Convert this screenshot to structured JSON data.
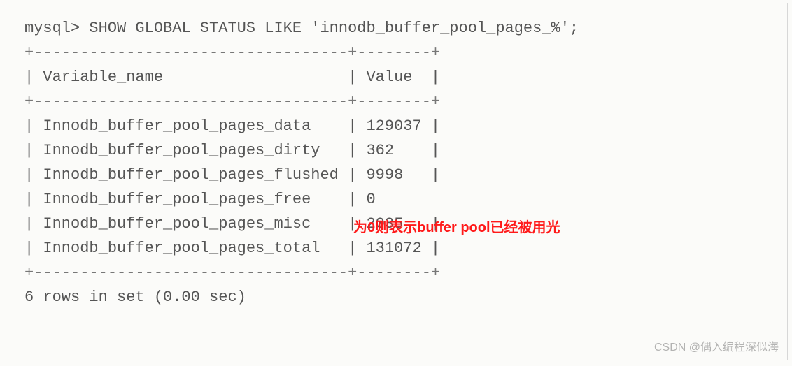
{
  "prompt": "mysql> ",
  "command": "SHOW GLOBAL STATUS LIKE 'innodb_buffer_pool_pages_%';",
  "border_top": "+----------------------------------+--------+",
  "header_line": "| Variable_name                    | Value  |",
  "border_mid": "+----------------------------------+--------+",
  "rows": [
    {
      "line": "| Innodb_buffer_pool_pages_data    | 129037 |",
      "name": "Innodb_buffer_pool_pages_data",
      "value": "129037"
    },
    {
      "line": "| Innodb_buffer_pool_pages_dirty   | 362    |",
      "name": "Innodb_buffer_pool_pages_dirty",
      "value": "362"
    },
    {
      "line": "| Innodb_buffer_pool_pages_flushed | 9998   |",
      "name": "Innodb_buffer_pool_pages_flushed",
      "value": "9998"
    },
    {
      "line": "| Innodb_buffer_pool_pages_free    | 0",
      "name": "Innodb_buffer_pool_pages_free",
      "value": "0"
    },
    {
      "line": "| Innodb_buffer_pool_pages_misc    | 2035   |",
      "name": "Innodb_buffer_pool_pages_misc",
      "value": "2035"
    },
    {
      "line": "| Innodb_buffer_pool_pages_total   | 131072 |",
      "name": "Innodb_buffer_pool_pages_total",
      "value": "131072"
    }
  ],
  "border_bot": "+----------------------------------+--------+",
  "footer": "6 rows in set (0.00 sec)",
  "annotation": "为0则表示buffer pool已经被用光",
  "watermark": "CSDN @偶入编程深似海",
  "chart_data": {
    "type": "table",
    "title": "SHOW GLOBAL STATUS LIKE 'innodb_buffer_pool_pages_%'",
    "columns": [
      "Variable_name",
      "Value"
    ],
    "rows": [
      [
        "Innodb_buffer_pool_pages_data",
        129037
      ],
      [
        "Innodb_buffer_pool_pages_dirty",
        362
      ],
      [
        "Innodb_buffer_pool_pages_flushed",
        9998
      ],
      [
        "Innodb_buffer_pool_pages_free",
        0
      ],
      [
        "Innodb_buffer_pool_pages_misc",
        2035
      ],
      [
        "Innodb_buffer_pool_pages_total",
        131072
      ]
    ],
    "summary": "6 rows in set (0.00 sec)",
    "annotation": {
      "row": "Innodb_buffer_pool_pages_free",
      "text": "为0则表示buffer pool已经被用光"
    }
  }
}
